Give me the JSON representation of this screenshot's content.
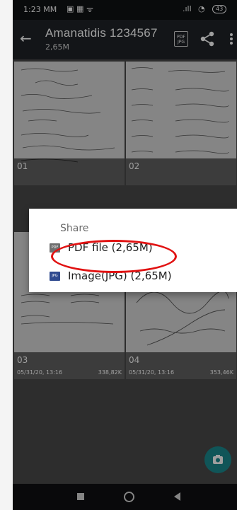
{
  "status_bar": {
    "time": "1:23 MM",
    "battery": "43"
  },
  "toolbar": {
    "title": "Amanatidis 1234567",
    "subtitle": "2,65M",
    "pdf_icon_top": "PDF",
    "pdf_icon_bottom": "JPG"
  },
  "pages": [
    {
      "number": "01",
      "date": "",
      "size": ""
    },
    {
      "number": "02",
      "date": "",
      "size": ""
    },
    {
      "number": "03",
      "date": "05/31/20, 13:16",
      "size": "338,82K"
    },
    {
      "number": "04",
      "date": "05/31/20, 13:16",
      "size": "353,46K"
    }
  ],
  "share_dialog": {
    "title": "Share",
    "options": [
      {
        "label": "PDF file (2,65M)",
        "icon": "pdf-file-icon",
        "icon_text": "PDF",
        "color": "#6f6f6f"
      },
      {
        "label": "Image(JPG) (2,65M)",
        "icon": "jpg-file-icon",
        "icon_text": "JPG",
        "color": "#2f4a8f"
      }
    ]
  },
  "colors": {
    "accent": "#1b8a8f",
    "highlight": "#e11212"
  }
}
